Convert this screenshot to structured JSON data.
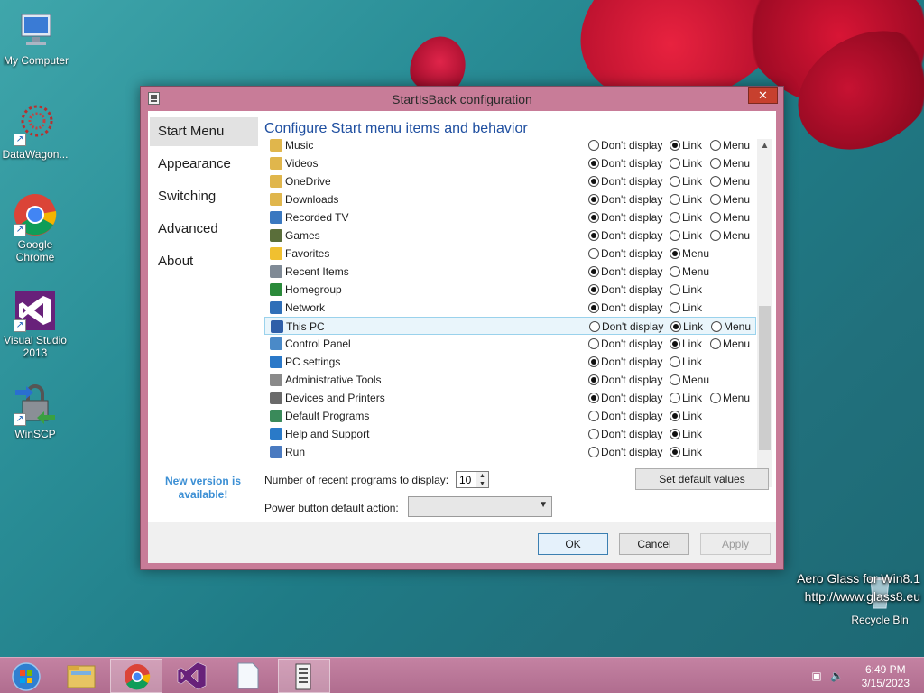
{
  "desktop": {
    "icons": [
      {
        "label": "My Computer"
      },
      {
        "label": "DataWagon..."
      },
      {
        "label": "Google Chrome"
      },
      {
        "label": "Visual Studio 2013"
      },
      {
        "label": "WinSCP"
      }
    ],
    "recycle_bin": "Recycle Bin",
    "watermark_line1": "Aero Glass for Win8.1",
    "watermark_line2": "http://www.glass8.eu"
  },
  "window": {
    "title": "StartIsBack configuration",
    "close_glyph": "✕",
    "sidebar": [
      "Start Menu",
      "Appearance",
      "Switching",
      "Advanced",
      "About"
    ],
    "new_version": "New version is available!",
    "heading": "Configure Start menu items and behavior",
    "option_labels": {
      "dont": "Don't display",
      "link": "Link",
      "menu": "Menu"
    },
    "rows": [
      {
        "label": "Music",
        "icon_color": "#e0b64c",
        "options": [
          "dont",
          "link",
          "menu"
        ],
        "selected": "link"
      },
      {
        "label": "Videos",
        "icon_color": "#e0b64c",
        "options": [
          "dont",
          "link",
          "menu"
        ],
        "selected": "dont"
      },
      {
        "label": "OneDrive",
        "icon_color": "#e0b64c",
        "options": [
          "dont",
          "link",
          "menu"
        ],
        "selected": "dont"
      },
      {
        "label": "Downloads",
        "icon_color": "#e0b64c",
        "options": [
          "dont",
          "link",
          "menu"
        ],
        "selected": "dont"
      },
      {
        "label": "Recorded TV",
        "icon_color": "#3a78c0",
        "options": [
          "dont",
          "link",
          "menu"
        ],
        "selected": "dont"
      },
      {
        "label": "Games",
        "icon_color": "#5a6e3a",
        "options": [
          "dont",
          "link",
          "menu"
        ],
        "selected": "dont"
      },
      {
        "label": "Favorites",
        "icon_color": "#f0c030",
        "options": [
          "dont",
          "menu"
        ],
        "selected": "menu"
      },
      {
        "label": "Recent Items",
        "icon_color": "#7f8a96",
        "options": [
          "dont",
          "menu"
        ],
        "selected": "dont"
      },
      {
        "label": "Homegroup",
        "icon_color": "#2a8a3a",
        "options": [
          "dont",
          "link"
        ],
        "selected": "dont"
      },
      {
        "label": "Network",
        "icon_color": "#2f6fb8",
        "options": [
          "dont",
          "link"
        ],
        "selected": "dont"
      },
      {
        "label": "This PC",
        "icon_color": "#2f5fa8",
        "options": [
          "dont",
          "link",
          "menu"
        ],
        "selected": "link",
        "highlight": true
      },
      {
        "label": "Control Panel",
        "icon_color": "#4a8ac8",
        "options": [
          "dont",
          "link",
          "menu"
        ],
        "selected": "link"
      },
      {
        "label": "PC settings",
        "icon_color": "#2a78c8",
        "options": [
          "dont",
          "link"
        ],
        "selected": "dont"
      },
      {
        "label": "Administrative Tools",
        "icon_color": "#8a8a8a",
        "options": [
          "dont",
          "menu"
        ],
        "selected": "dont"
      },
      {
        "label": "Devices and Printers",
        "icon_color": "#6a6a6a",
        "options": [
          "dont",
          "link",
          "menu"
        ],
        "selected": "dont"
      },
      {
        "label": "Default Programs",
        "icon_color": "#3a8a5a",
        "options": [
          "dont",
          "link"
        ],
        "selected": "link"
      },
      {
        "label": "Help and Support",
        "icon_color": "#2a7ac8",
        "options": [
          "dont",
          "link"
        ],
        "selected": "link"
      },
      {
        "label": "Run",
        "icon_color": "#4a7ac0",
        "options": [
          "dont",
          "link"
        ],
        "selected": "link"
      }
    ],
    "recent_label": "Number of recent programs to display:",
    "recent_value": "10",
    "set_default": "Set default values",
    "power_label": "Power button default action:",
    "power_value": "",
    "ok": "OK",
    "cancel": "Cancel",
    "apply": "Apply"
  },
  "taskbar": {
    "time": "6:49 PM",
    "date": "3/15/2023"
  }
}
